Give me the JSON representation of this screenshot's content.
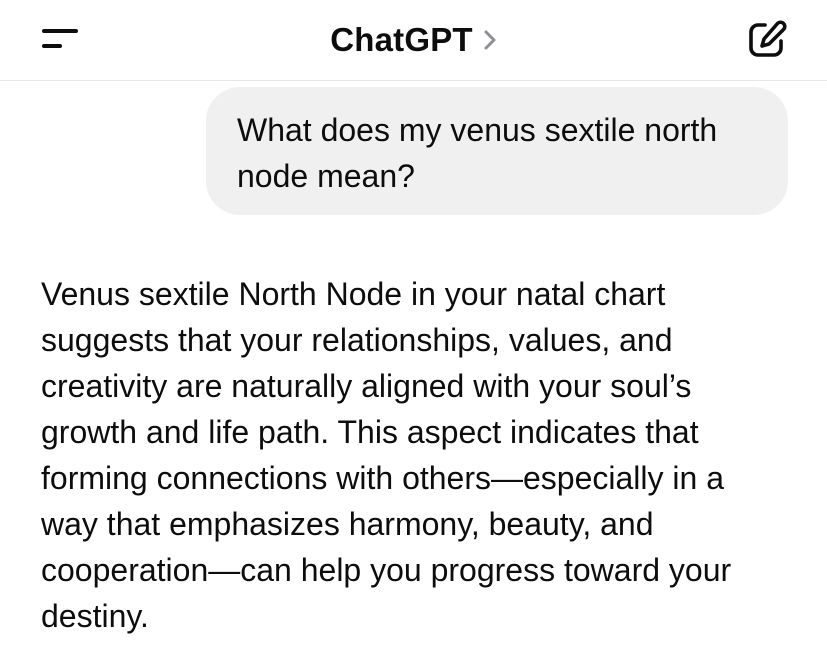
{
  "header": {
    "title": "ChatGPT",
    "icons": {
      "menu": "menu-icon",
      "title_chevron": "chevron-right-icon",
      "new_chat": "new-chat-icon"
    }
  },
  "conversation": {
    "user_message": "What does my venus sextile north node mean?",
    "assistant_message": "Venus sextile North Node in your natal chart suggests that your relationships, values, and creativity are naturally aligned with your soul’s growth and life path. This aspect indicates that forming connections with others—especially in a way that emphasizes harmony, beauty, and cooperation—can help you progress toward your destiny."
  },
  "colors": {
    "background": "#ffffff",
    "text": "#0d0d0d",
    "user_bubble": "#f0f0f0",
    "divider": "#e6e6e6",
    "chevron": "#8e8e93"
  }
}
